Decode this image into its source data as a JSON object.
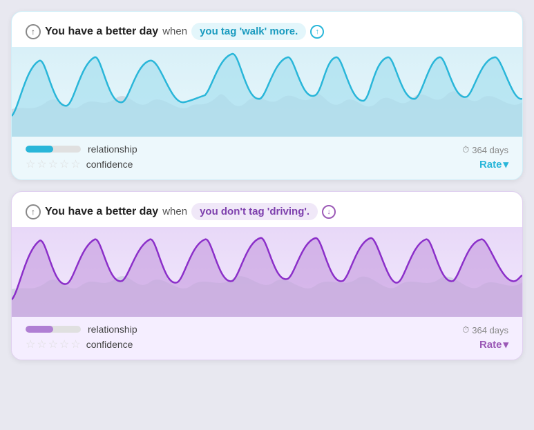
{
  "cards": [
    {
      "id": "walk-card",
      "color": "blue",
      "header": {
        "arrow_type": "up",
        "main_text": "You have a better day",
        "when_text": "when",
        "highlight_text": "you tag 'walk' more.",
        "trailing_arrow": "up"
      },
      "chart": {
        "type": "blue",
        "bg_color": "#c8edf8",
        "line_color": "#29b6d9",
        "gray_color": "#b0b8c4"
      },
      "footer": {
        "bar_label": "relationship",
        "bar_fill": "blue",
        "confidence_label": "confidence",
        "stars": [
          0,
          0,
          0,
          0,
          0
        ],
        "days": "364 days",
        "rate_label": "Rate"
      }
    },
    {
      "id": "driving-card",
      "color": "purple",
      "header": {
        "arrow_type": "up",
        "main_text": "You have a better day",
        "when_text": "when",
        "highlight_text": "you don't tag 'driving'.",
        "trailing_arrow": "down"
      },
      "chart": {
        "type": "purple",
        "bg_color": "#d8bef0",
        "line_color": "#9b50cc",
        "gray_color": "#b0b8c4"
      },
      "footer": {
        "bar_label": "relationship",
        "bar_fill": "purple",
        "confidence_label": "confidence",
        "stars": [
          0,
          0,
          0,
          0,
          0
        ],
        "days": "364 days",
        "rate_label": "Rate"
      }
    }
  ]
}
